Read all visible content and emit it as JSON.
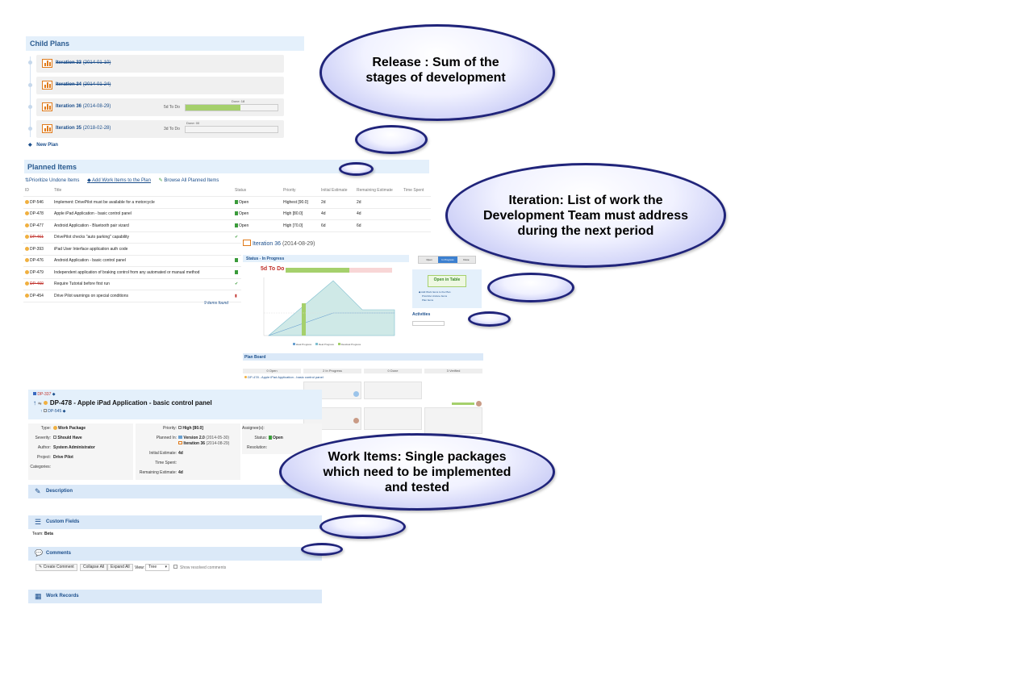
{
  "child_plans": {
    "title": "Child Plans",
    "items": [
      {
        "name": "Iteration 33",
        "date": "(2014-01-10)",
        "done": true
      },
      {
        "name": "Iteration 34",
        "date": "(2014-01-24)",
        "done": true
      },
      {
        "name": "Iteration 36",
        "date": "(2014-08-29)",
        "done": false,
        "todo": "5d To Do",
        "progress_label": "Done: 18",
        "progress": 0.6
      },
      {
        "name": "Iteration 35",
        "date": "(2018-02-28)",
        "done": false,
        "todo": "3d To Do",
        "progress_label": "Done: 00",
        "progress": 0.0
      }
    ],
    "new_plan": "New Plan"
  },
  "planned_items": {
    "title": "Planned Items",
    "actions": [
      "Prioritize Undone Items",
      "Add Work Items to the Plan",
      "Browse All Planned Items"
    ],
    "columns": [
      "ID",
      "Title",
      "Status",
      "Priority",
      "Initial Estimate",
      "Remaining Estimate",
      "Time Spent"
    ],
    "rows": [
      {
        "id": "DP-546",
        "title": "Implement: DrivePilot must be available for a motorcycle",
        "status": "Open",
        "priority": "Highest [90.0]",
        "initial": "2d",
        "remaining": "2d",
        "strike": false
      },
      {
        "id": "DP-478",
        "title": "Apple iPad Application - basic control panel",
        "status": "Open",
        "priority": "High [80.0]",
        "initial": "4d",
        "remaining": "4d",
        "strike": false
      },
      {
        "id": "DP-477",
        "title": "Android Application - Bluetooth pair vizard",
        "status": "Open",
        "priority": "High [70.0]",
        "initial": "6d",
        "remaining": "6d",
        "strike": false
      },
      {
        "id": "DP-461",
        "title": "DrivePilot checks \"auto parking\" capability",
        "status": "",
        "priority": "",
        "initial": "",
        "remaining": "",
        "strike": true
      },
      {
        "id": "DP-393",
        "title": "iPad User Interface application auth code",
        "status": "",
        "priority": "",
        "initial": "",
        "remaining": "",
        "strike": false
      },
      {
        "id": "DP-476",
        "title": "Android Application - basic control panel",
        "status": "",
        "priority": "",
        "initial": "",
        "remaining": "",
        "strike": false
      },
      {
        "id": "DP-479",
        "title": "Independent application of braking control from any automated or manual method",
        "status": "",
        "priority": "",
        "initial": "",
        "remaining": "",
        "strike": false
      },
      {
        "id": "DP-460",
        "title": "Require Tutorial before first run",
        "status": "",
        "priority": "",
        "initial": "",
        "remaining": "",
        "strike": true
      },
      {
        "id": "DP-454",
        "title": "Drive Pilot warnings on special conditions",
        "status": "",
        "priority": "",
        "initial": "",
        "remaining": "",
        "strike": false
      }
    ],
    "found": "9 items found"
  },
  "iteration_panel": {
    "title": "Iteration 36",
    "date": "(2014-08-29)",
    "status_header": "Status - In Progress",
    "todo": "5d To Do",
    "tabs": [
      "Open",
      "In Progress",
      "Done"
    ],
    "open_in_table": "Open in Table",
    "side_links": [
      "Add Work Items to the Plan",
      "Prioritize Undone Items",
      "Plan Items"
    ],
    "activities": "Activities",
    "legend": [
      "Ideal Progress",
      "Real Progress",
      "Residual Progress"
    ]
  },
  "plan_board": {
    "title": "Plan Board",
    "columns": [
      "0 Open",
      "2 In Progress",
      "0 Done",
      "3 Verified"
    ],
    "row_label": "DP-478 - Apple iPad Application - basic control panel"
  },
  "work_item": {
    "parent": "DP-337",
    "title": "DP-478 - Apple iPad Application - basic control panel",
    "child": "DP-545",
    "fields_left": [
      {
        "label": "Type:",
        "value": "Work Package"
      },
      {
        "label": "Severity:",
        "value": "Should Have"
      },
      {
        "label": "Author:",
        "value": "System Administrator"
      },
      {
        "label": "Project:",
        "value": "Drive Pilot"
      },
      {
        "label": "Categories:",
        "value": ""
      }
    ],
    "fields_mid": [
      {
        "label": "Priority:",
        "value": "High [80.0]"
      },
      {
        "label": "Planned In:",
        "value": "Version 2.0",
        "date": "(2014-05-30)"
      },
      {
        "label": "",
        "value": "Iteration 36",
        "date": "(2014-08-29)"
      },
      {
        "label": "Initial Estimate:",
        "value": "4d"
      },
      {
        "label": "Time Spent:",
        "value": ""
      },
      {
        "label": "Remaining Estimate:",
        "value": "4d"
      }
    ],
    "fields_right": [
      {
        "label": "Assignee(s):",
        "value": ""
      },
      {
        "label": "Status:",
        "value": "Open"
      },
      {
        "label": "Resolution:",
        "value": ""
      }
    ],
    "sections": {
      "description": "Description",
      "custom_fields": "Custom Fields",
      "comments": "Comments",
      "work_records": "Work Records"
    },
    "team_label": "Team:",
    "team_value": "Beta",
    "comment_buttons": [
      "Create Comment",
      "Collapse All",
      "Expand All"
    ],
    "view_label": "View:",
    "view_value": "Tree",
    "show_resolved": "Show resolved comments"
  },
  "callouts": {
    "release": "Release : Sum of the stages of development",
    "iteration": "Iteration: List of work the Development Team must address during the next period",
    "work_items": "Work Items: Single packages which need to be implemented and tested"
  },
  "colors": {
    "header_bg": "#e4f0fb",
    "link": "#1c4f8c",
    "progress_green": "#a5d06c",
    "bubble_border": "#20247a",
    "red_todo": "#c0302a"
  }
}
